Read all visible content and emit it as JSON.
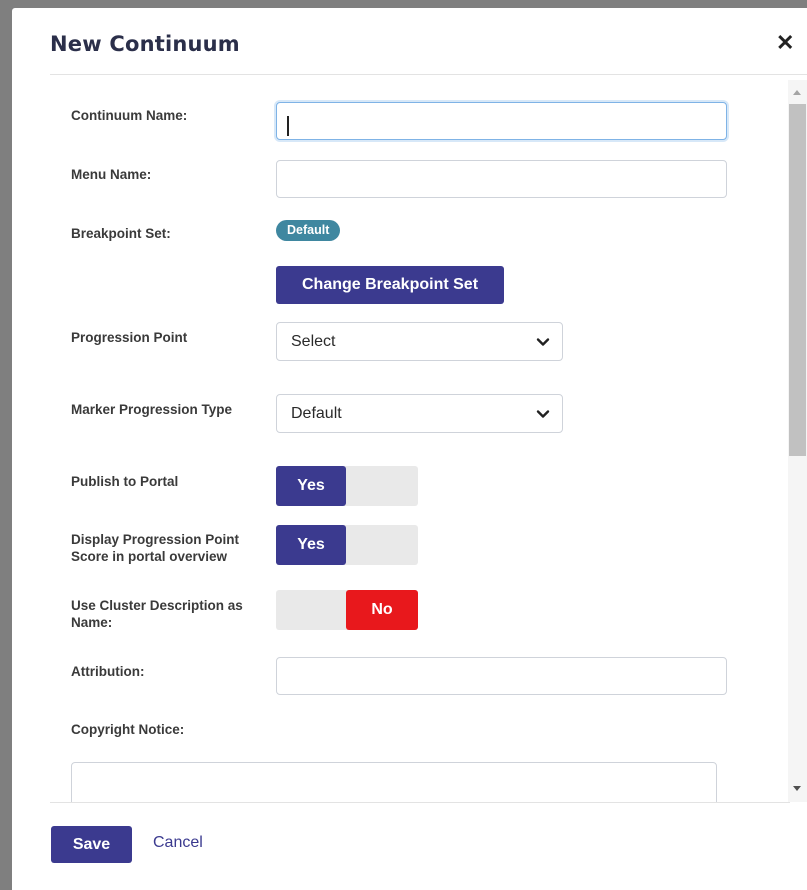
{
  "dialog": {
    "title": "New Continuum",
    "close_glyph": "✕"
  },
  "form": {
    "continuum_name": {
      "label": "Continuum Name:",
      "value": ""
    },
    "menu_name": {
      "label": "Menu Name:",
      "value": ""
    },
    "breakpoint_set": {
      "label": "Breakpoint Set:",
      "badge": "Default",
      "change_button": "Change Breakpoint Set"
    },
    "progression_point": {
      "label": "Progression Point",
      "selected": "Select"
    },
    "marker_progression_type": {
      "label": "Marker Progression Type",
      "selected": "Default"
    },
    "publish_to_portal": {
      "label": "Publish to Portal",
      "state": "Yes"
    },
    "display_progression_point": {
      "label_line1": "Display Progression Point",
      "label_line2": "Score in portal overview",
      "state": "Yes"
    },
    "use_cluster_description": {
      "label_line1": "Use Cluster Description as",
      "label_line2": "Name:",
      "state": "No"
    },
    "attribution": {
      "label": "Attribution:",
      "value": ""
    },
    "copyright_notice": {
      "label": "Copyright Notice:",
      "value": ""
    }
  },
  "footer": {
    "save_label": "Save",
    "cancel_label": "Cancel"
  },
  "colors": {
    "primary": "#3b3a8f",
    "badge": "#3f87a0",
    "no_toggle": "#e8181c"
  }
}
